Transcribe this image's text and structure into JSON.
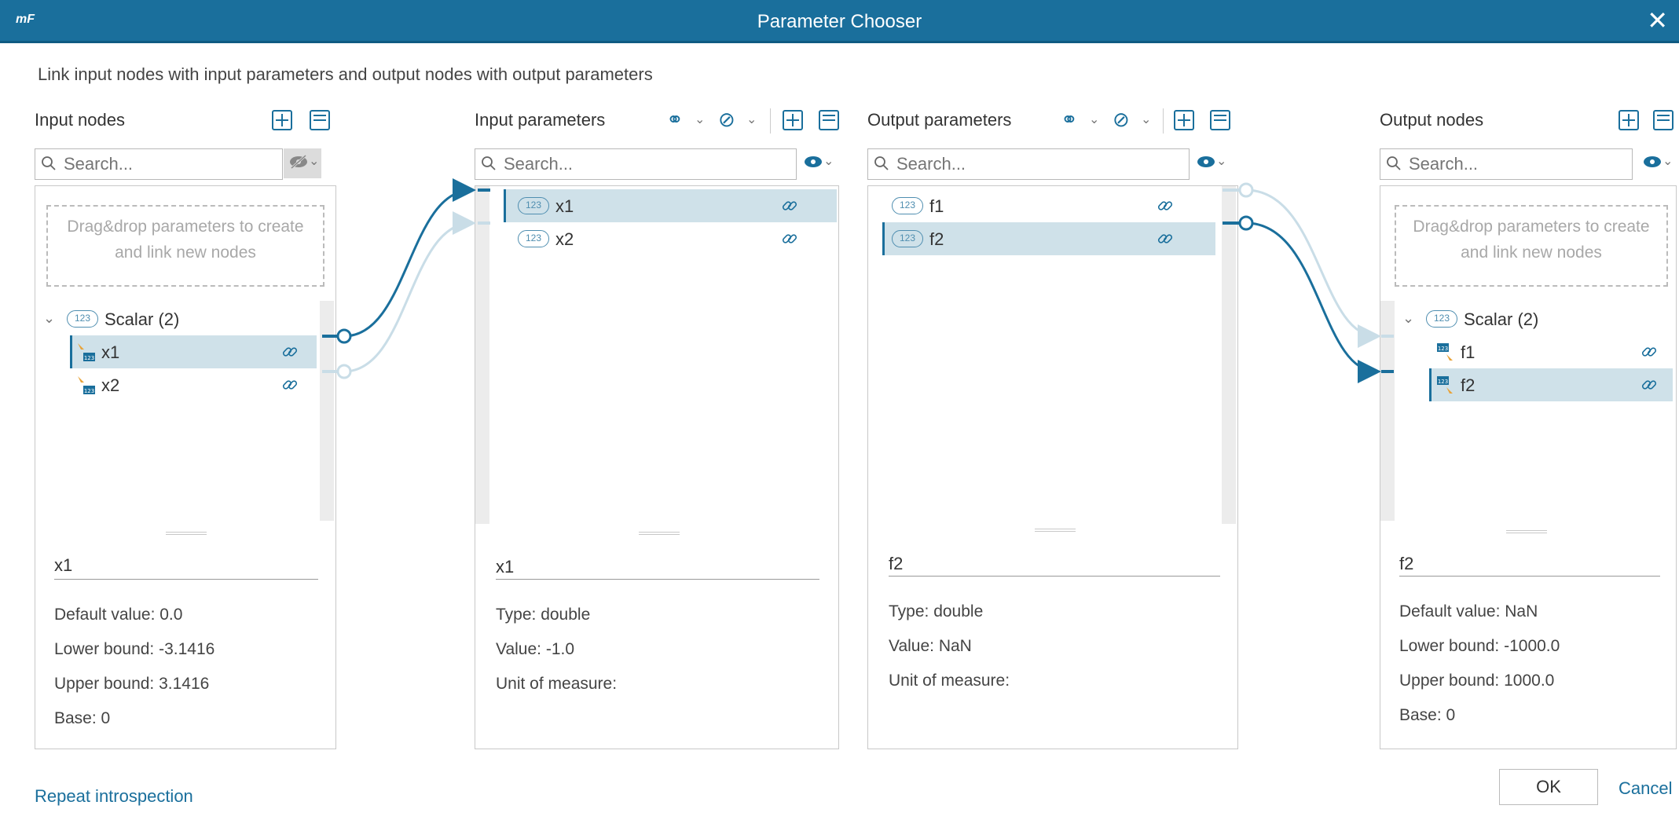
{
  "window": {
    "logo": "mF",
    "title": "Parameter Chooser",
    "close_glyph": "✕"
  },
  "instruction": "Link input nodes with input parameters and output nodes with output parameters",
  "colors": {
    "accent": "#1a6f9c",
    "selected_row": "#cfe1e9",
    "link_faded": "#c9dde7"
  },
  "input_nodes": {
    "title": "Input nodes",
    "search_placeholder": "Search...",
    "dropzone": [
      "Drag&drop parameters to create",
      "and link new nodes"
    ],
    "group": {
      "label": "Scalar (2)",
      "badge": "123"
    },
    "items": [
      {
        "label": "x1",
        "selected": true
      },
      {
        "label": "x2",
        "selected": false
      }
    ],
    "details": {
      "name": "x1",
      "props": [
        "Default value: 0.0",
        "Lower bound: -3.1416",
        "Upper bound: 3.1416",
        "Base: 0"
      ]
    }
  },
  "input_parameters": {
    "title": "Input parameters",
    "search_placeholder": "Search...",
    "items": [
      {
        "label": "x1",
        "badge": "123",
        "selected": true
      },
      {
        "label": "x2",
        "badge": "123",
        "selected": false
      }
    ],
    "details": {
      "name": "x1",
      "props": [
        "Type: double",
        "Value: -1.0",
        "Unit of measure:"
      ]
    }
  },
  "output_parameters": {
    "title": "Output parameters",
    "search_placeholder": "Search...",
    "items": [
      {
        "label": "f1",
        "badge": "123",
        "selected": false
      },
      {
        "label": "f2",
        "badge": "123",
        "selected": true
      }
    ],
    "details": {
      "name": "f2",
      "props": [
        "Type: double",
        "Value: NaN",
        "Unit of measure:"
      ]
    }
  },
  "output_nodes": {
    "title": "Output nodes",
    "search_placeholder": "Search...",
    "dropzone": [
      "Drag&drop parameters to create",
      "and link new nodes"
    ],
    "group": {
      "label": "Scalar (2)",
      "badge": "123"
    },
    "items": [
      {
        "label": "f1",
        "selected": false
      },
      {
        "label": "f2",
        "selected": true
      }
    ],
    "details": {
      "name": "f2",
      "props": [
        "Default value: NaN",
        "Lower bound: -1000.0",
        "Upper bound: 1000.0",
        "Base: 0"
      ]
    }
  },
  "footer": {
    "repeat_label": "Repeat introspection",
    "ok_label": "OK",
    "cancel_label": "Cancel"
  }
}
